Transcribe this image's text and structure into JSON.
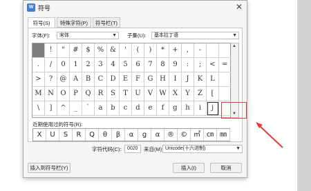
{
  "dialog": {
    "title": "符号",
    "app_icon": "W",
    "close_glyph": "✕"
  },
  "tabs": [
    "符号(S)",
    "特殊字符(P)",
    "符号栏(T)"
  ],
  "font": {
    "label": "字体(F):",
    "value": "宋体"
  },
  "subset": {
    "label": "子集(U):",
    "value": "基本拉丁语"
  },
  "symbols": [
    " ",
    "!",
    "\"",
    "#",
    "$",
    "%",
    "&",
    "'",
    "(",
    ")",
    "*",
    "+",
    ",",
    "-",
    "",
    "",
    ".",
    "/",
    "0",
    "1",
    "2",
    "3",
    "4",
    "5",
    "6",
    "7",
    "8",
    "9",
    ":",
    ";",
    "<",
    "=",
    ">",
    "?",
    "@",
    "A",
    "B",
    "C",
    "D",
    "E",
    "F",
    "G",
    "H",
    "I",
    "J",
    "K",
    "L",
    "",
    "M",
    "N",
    "O",
    "P",
    "Q",
    "R",
    "S",
    "T",
    "U",
    "V",
    "W",
    "X",
    "Y",
    "Z",
    "[",
    "",
    "\\",
    "]",
    "^",
    "_",
    "`",
    "a",
    "b",
    "c",
    "d",
    "e",
    "f",
    "g",
    "h",
    "i",
    "j",
    ""
  ],
  "recent": {
    "label": "近期使用过的符号(R):",
    "items": [
      "X",
      "U",
      "S",
      "R",
      "Q",
      "θ",
      "β",
      "α",
      "g",
      "α",
      "®",
      "©",
      "㎡",
      "㎝",
      "㎜"
    ]
  },
  "char_code": {
    "label": "字符代码(C):",
    "value": "0020"
  },
  "from": {
    "label": "来自(M)",
    "value": "Unicode(十六进制)"
  },
  "buttons": {
    "insert_to_bar": "插入到符号栏(Y)",
    "insert": "插入(I)",
    "cancel": "取消"
  },
  "colors": {
    "annotation": "#e53935",
    "selected_cell": "#7c7c7c"
  }
}
